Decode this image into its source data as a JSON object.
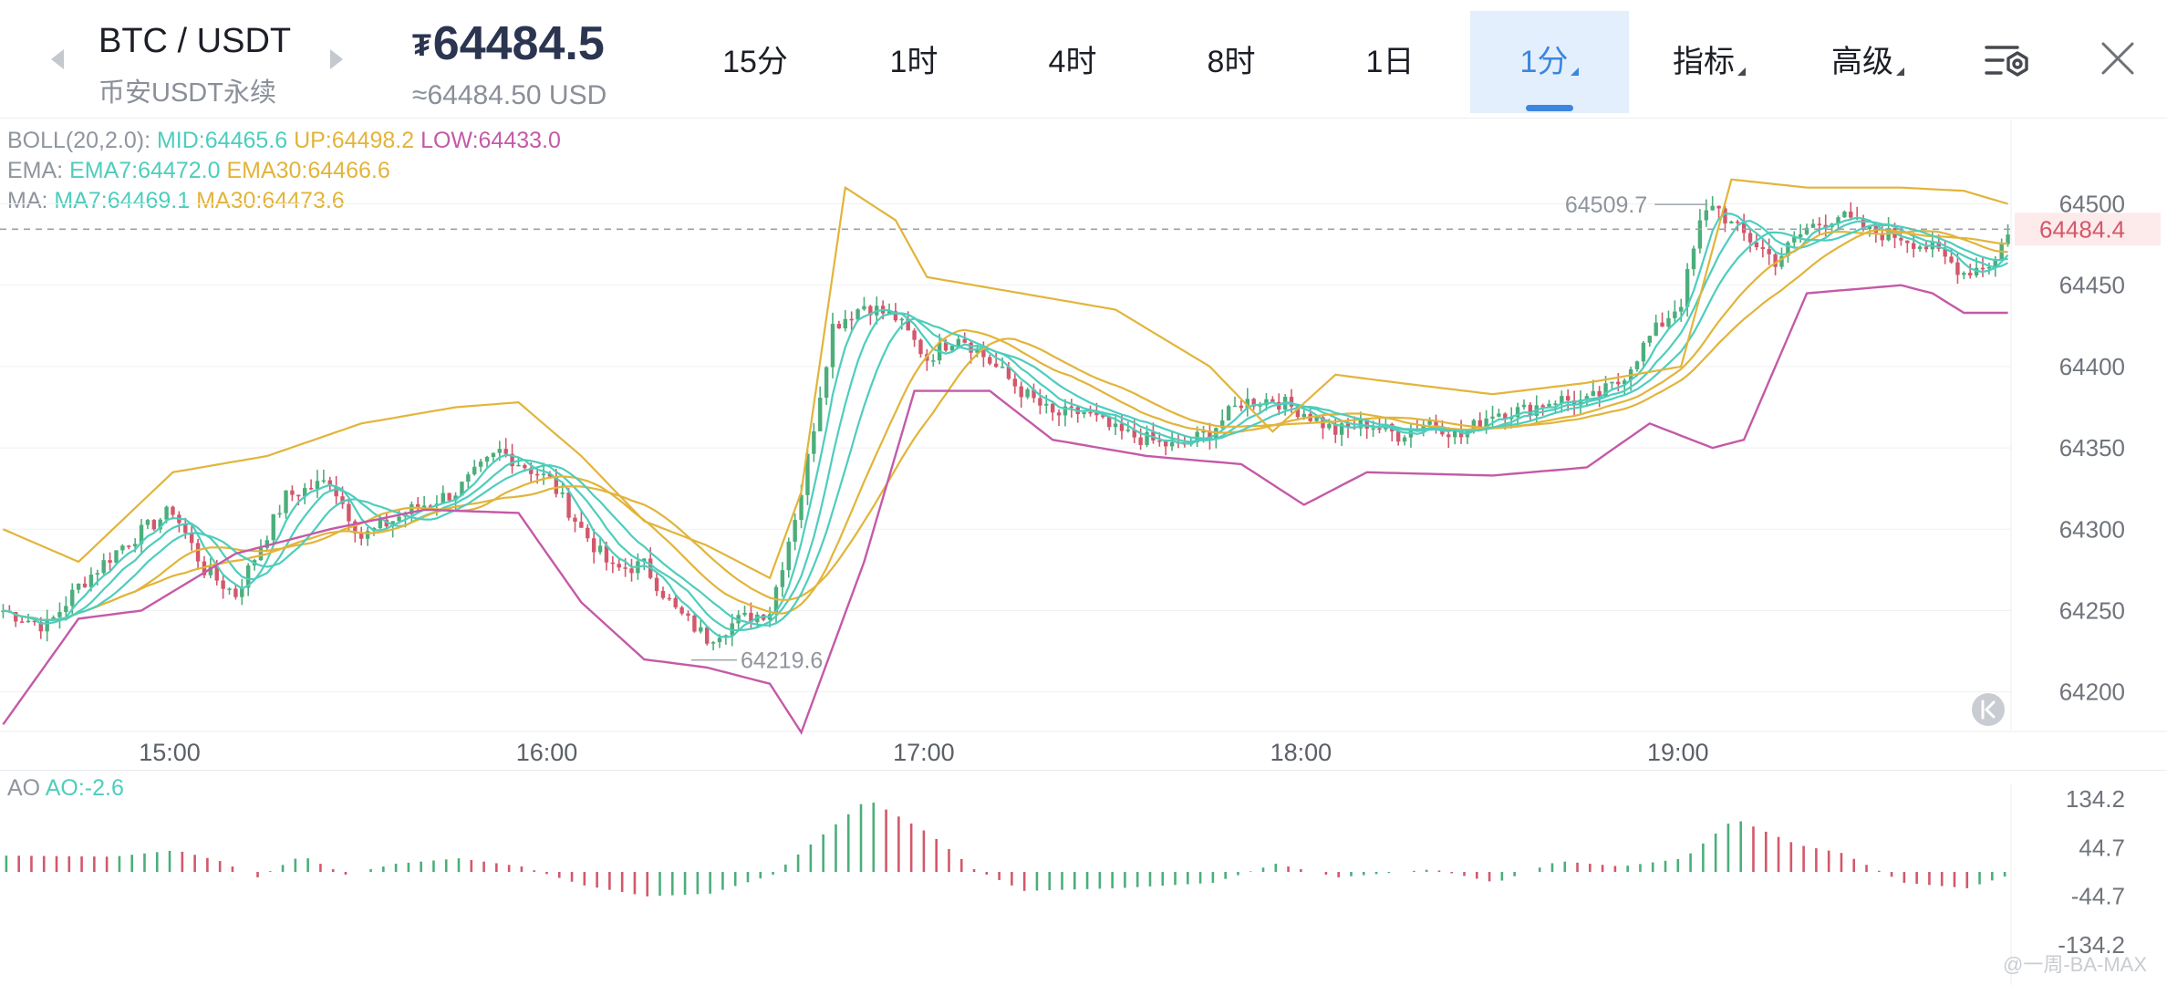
{
  "header": {
    "pair": "BTC / USDT",
    "exchange": "币安USDT永续",
    "price": "64484.5",
    "currency_glyph": "₮",
    "price_usd": "≈64484.50 USD",
    "tabs": [
      {
        "label": "15分"
      },
      {
        "label": "1时"
      },
      {
        "label": "4时"
      },
      {
        "label": "8时"
      },
      {
        "label": "1日"
      },
      {
        "label": "1分"
      },
      {
        "label": "指标"
      },
      {
        "label": "高级"
      }
    ],
    "icons": [
      "settings-list-icon",
      "close-icon"
    ]
  },
  "indicators": {
    "boll": {
      "name": "BOLL(20,2.0):",
      "mid": "MID:64465.6",
      "up": "UP:64498.2",
      "low": "LOW:64433.0"
    },
    "ema": {
      "name": "EMA:",
      "ema7": "EMA7:64472.0",
      "ema30": "EMA30:64466.6"
    },
    "ma": {
      "name": "MA:",
      "ma7": "MA7:64469.1",
      "ma30": "MA30:64473.6"
    },
    "ao": {
      "name": "AO",
      "value": "AO:-2.6"
    }
  },
  "colors": {
    "up": "#4cae7b",
    "down": "#d2586b",
    "teal": "#4ecdbd",
    "gold": "#e2b43a",
    "magenta": "#c45aa8",
    "accent": "#3b86de"
  },
  "chart_data": {
    "type": "candlestick",
    "symbol": "BTC / USDT",
    "interval": "1分",
    "x_ticks": [
      "15:00",
      "16:00",
      "17:00",
      "18:00",
      "19:00"
    ],
    "y_ticks": [
      "64500",
      "64450",
      "64400",
      "64350",
      "64300",
      "64250",
      "64200"
    ],
    "ylim": [
      64160,
      64530
    ],
    "current_price": "64484.4",
    "annotations": {
      "high": "64509.7",
      "low": "64219.6"
    },
    "close_path": [
      [
        "14:33",
        64250
      ],
      [
        "14:40",
        64240
      ],
      [
        "14:45",
        64265
      ],
      [
        "14:52",
        64290
      ],
      [
        "15:00",
        64312
      ],
      [
        "15:05",
        64275
      ],
      [
        "15:10",
        64260
      ],
      [
        "15:18",
        64320
      ],
      [
        "15:25",
        64330
      ],
      [
        "15:30",
        64295
      ],
      [
        "15:38",
        64312
      ],
      [
        "15:45",
        64323
      ],
      [
        "15:52",
        64348
      ],
      [
        "16:00",
        64330
      ],
      [
        "16:05",
        64300
      ],
      [
        "16:10",
        64275
      ],
      [
        "16:15",
        64278
      ],
      [
        "16:20",
        64250
      ],
      [
        "16:25",
        64233
      ],
      [
        "16:30",
        64244
      ],
      [
        "16:35",
        64250
      ],
      [
        "16:40",
        64323
      ],
      [
        "16:45",
        64425
      ],
      [
        "16:50",
        64438
      ],
      [
        "16:55",
        64430
      ],
      [
        "17:00",
        64405
      ],
      [
        "17:05",
        64420
      ],
      [
        "17:10",
        64403
      ],
      [
        "17:15",
        64385
      ],
      [
        "17:20",
        64370
      ],
      [
        "17:25",
        64372
      ],
      [
        "17:30",
        64360
      ],
      [
        "17:35",
        64355
      ],
      [
        "17:40",
        64350
      ],
      [
        "17:45",
        64360
      ],
      [
        "17:50",
        64378
      ],
      [
        "17:55",
        64380
      ],
      [
        "18:00",
        64372
      ],
      [
        "18:05",
        64360
      ],
      [
        "18:10",
        64365
      ],
      [
        "18:15",
        64358
      ],
      [
        "18:20",
        64367
      ],
      [
        "18:25",
        64357
      ],
      [
        "18:30",
        64372
      ],
      [
        "18:35",
        64373
      ],
      [
        "18:40",
        64380
      ],
      [
        "18:45",
        64378
      ],
      [
        "18:50",
        64390
      ],
      [
        "18:55",
        64418
      ],
      [
        "19:00",
        64440
      ],
      [
        "19:03",
        64487
      ],
      [
        "19:05",
        64501
      ],
      [
        "19:08",
        64487
      ],
      [
        "19:12",
        64475
      ],
      [
        "19:15",
        64465
      ],
      [
        "19:20",
        64485
      ],
      [
        "19:25",
        64493
      ],
      [
        "19:30",
        64483
      ],
      [
        "19:35",
        64480
      ],
      [
        "19:40",
        64472
      ],
      [
        "19:45",
        64458
      ],
      [
        "19:50",
        64465
      ],
      [
        "19:52",
        64484
      ]
    ],
    "boll_upper": [
      [
        "14:33",
        64300
      ],
      [
        "14:45",
        64280
      ],
      [
        "15:00",
        64335
      ],
      [
        "15:15",
        64345
      ],
      [
        "15:30",
        64365
      ],
      [
        "15:45",
        64375
      ],
      [
        "15:55",
        64378
      ],
      [
        "16:05",
        64345
      ],
      [
        "16:15",
        64305
      ],
      [
        "16:25",
        64290
      ],
      [
        "16:35",
        64270
      ],
      [
        "16:40",
        64323
      ],
      [
        "16:47",
        64510
      ],
      [
        "16:55",
        64490
      ],
      [
        "17:00",
        64455
      ],
      [
        "17:15",
        64445
      ],
      [
        "17:30",
        64435
      ],
      [
        "17:45",
        64400
      ],
      [
        "17:55",
        64360
      ],
      [
        "18:05",
        64395
      ],
      [
        "18:15",
        64390
      ],
      [
        "18:30",
        64383
      ],
      [
        "18:45",
        64390
      ],
      [
        "19:00",
        64400
      ],
      [
        "19:08",
        64515
      ],
      [
        "19:20",
        64510
      ],
      [
        "19:35",
        64510
      ],
      [
        "19:45",
        64508
      ],
      [
        "19:52",
        64500
      ]
    ],
    "boll_lower": [
      [
        "14:33",
        64180
      ],
      [
        "14:45",
        64245
      ],
      [
        "14:55",
        64250
      ],
      [
        "15:10",
        64285
      ],
      [
        "15:25",
        64300
      ],
      [
        "15:40",
        64312
      ],
      [
        "15:55",
        64310
      ],
      [
        "16:05",
        64255
      ],
      [
        "16:15",
        64220
      ],
      [
        "16:25",
        64215
      ],
      [
        "16:35",
        64205
      ],
      [
        "16:40",
        64175
      ],
      [
        "16:50",
        64280
      ],
      [
        "16:58",
        64385
      ],
      [
        "17:10",
        64385
      ],
      [
        "17:20",
        64355
      ],
      [
        "17:35",
        64345
      ],
      [
        "17:50",
        64340
      ],
      [
        "18:00",
        64315
      ],
      [
        "18:10",
        64335
      ],
      [
        "18:30",
        64333
      ],
      [
        "18:45",
        64338
      ],
      [
        "18:55",
        64365
      ],
      [
        "19:05",
        64350
      ],
      [
        "19:10",
        64355
      ],
      [
        "19:20",
        64445
      ],
      [
        "19:35",
        64450
      ],
      [
        "19:40",
        64445
      ],
      [
        "19:45",
        64433
      ],
      [
        "19:52",
        64433
      ]
    ],
    "ao_y_ticks": [
      "134.2",
      "44.7",
      "-44.7",
      "-134.2"
    ],
    "ao_ylim": [
      -150,
      150
    ],
    "ao_values": [
      [
        "14:33",
        30
      ],
      [
        "14:50",
        28
      ],
      [
        "15:00",
        40
      ],
      [
        "15:07",
        20
      ],
      [
        "15:13",
        -10
      ],
      [
        "15:20",
        30
      ],
      [
        "15:27",
        -5
      ],
      [
        "15:35",
        15
      ],
      [
        "15:45",
        25
      ],
      [
        "15:55",
        10
      ],
      [
        "16:05",
        -25
      ],
      [
        "16:15",
        -45
      ],
      [
        "16:25",
        -40
      ],
      [
        "16:35",
        -5
      ],
      [
        "16:50",
        134
      ],
      [
        "17:00",
        70
      ],
      [
        "17:07",
        5
      ],
      [
        "17:15",
        -35
      ],
      [
        "17:30",
        -30
      ],
      [
        "17:45",
        -20
      ],
      [
        "17:55",
        15
      ],
      [
        "18:05",
        -10
      ],
      [
        "18:20",
        5
      ],
      [
        "18:30",
        -20
      ],
      [
        "18:40",
        20
      ],
      [
        "18:50",
        10
      ],
      [
        "19:00",
        25
      ],
      [
        "19:08",
        98
      ],
      [
        "19:18",
        50
      ],
      [
        "19:25",
        35
      ],
      [
        "19:35",
        -20
      ],
      [
        "19:45",
        -30
      ],
      [
        "19:52",
        -5
      ]
    ]
  },
  "watermark": "@一周-BA-MAX"
}
